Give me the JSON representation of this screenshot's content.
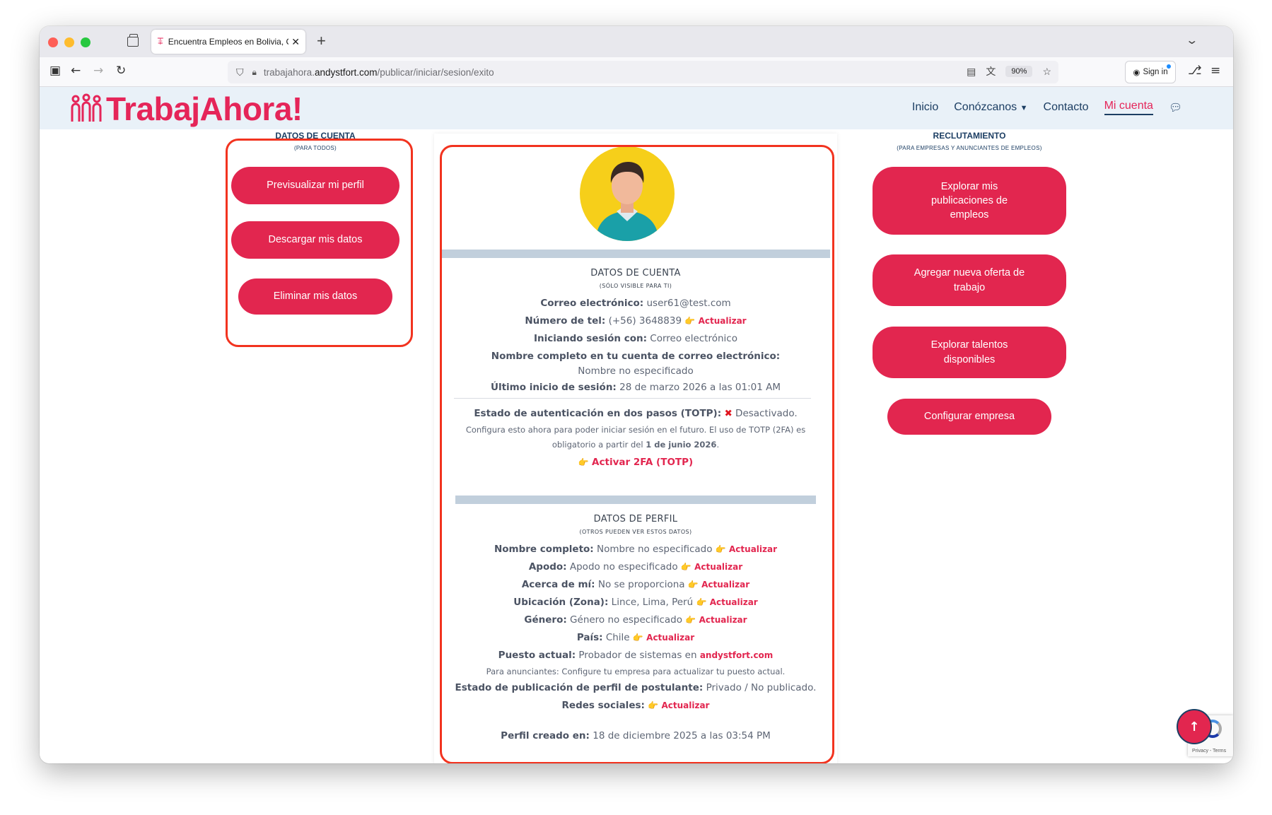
{
  "browser": {
    "tab_title": "Encuentra Empleos en Bolivia, C",
    "url_prefix": "trabajahora.",
    "url_domain": "andystfort.com",
    "url_path": "/publicar/iniciar/sesion/exito",
    "zoom": "90%",
    "signin_label": "Sign in",
    "icons": [
      "tabs-icon",
      "back-arrow-icon",
      "forward-arrow-icon",
      "reload-icon",
      "shield-icon",
      "lock-icon",
      "reader-icon",
      "translate-icon",
      "star-icon",
      "extensions-icon",
      "menu-icon"
    ]
  },
  "site": {
    "logo_text": "TrabajAhora!",
    "nav": {
      "inicio": "Inicio",
      "conozcanos": "Conózcanos",
      "contacto": "Contacto",
      "mi_cuenta": "Mi cuenta"
    }
  },
  "left": {
    "title": "DATOS DE CUENTA",
    "subtitle": "(PARA TODOS)",
    "buttons": {
      "preview": "Previsualizar mi perfil",
      "download": "Descargar mis datos",
      "delete": "Eliminar mis datos"
    }
  },
  "right": {
    "title": "RECLUTAMIENTO",
    "subtitle": "(PARA EMPRESAS Y ANUNCIANTES DE EMPLEOS)",
    "buttons": {
      "explore_posts": "Explorar mis publicaciones de empleos",
      "add_offer": "Agregar nueva oferta de trabajo",
      "explore_talent": "Explorar talentos disponibles",
      "config_company": "Configurar empresa"
    }
  },
  "account": {
    "title": "DATOS DE CUENTA",
    "subtitle": "(SÓLO VISIBLE PARA TI)",
    "email_label": "Correo electrónico:",
    "email_value": "user61@test.com",
    "phone_label": "Número de tel:",
    "phone_value": "(+56) 3648839",
    "login_label": "Iniciando sesión con:",
    "login_value": "Correo electrónico",
    "fullname_label": "Nombre completo en tu cuenta de correo electrónico:",
    "fullname_value": "Nombre no especificado",
    "last_login_label": "Último inicio de sesión:",
    "last_login_value": "28 de marzo 2026 a las 01:01 AM",
    "totp_label": "Estado de autenticación en dos pasos (TOTP):",
    "totp_value": "Desactivado.",
    "totp_note_1": "Configura esto ahora para poder iniciar sesión en el futuro. El uso de TOTP (2FA) es obligatorio a partir del",
    "totp_note_date": "1 de junio 2026",
    "totp_note_end": ".",
    "activate_link": "Activar 2FA (TOTP)",
    "update_label": "Actualizar"
  },
  "profile": {
    "title": "DATOS DE PERFIL",
    "subtitle": "(OTROS PUEDEN VER ESTOS DATOS)",
    "name_label": "Nombre completo:",
    "name_value": "Nombre no especificado",
    "nick_label": "Apodo:",
    "nick_value": "Apodo no especificado",
    "about_label": "Acerca de mí:",
    "about_value": "No se proporciona",
    "location_label": "Ubicación (Zona):",
    "location_value": "Lince, Lima, Perú",
    "gender_label": "Género:",
    "gender_value": "Género no especificado",
    "country_label": "País:",
    "country_value": "Chile",
    "job_label": "Puesto actual:",
    "job_value": "Probador de sistemas en",
    "job_company": "andystfort.com",
    "advertiser_note": "Para anunciantes: Configure tu empresa para actualizar tu puesto actual.",
    "status_label": "Estado de publicación de perfil de postulante:",
    "status_value": "Privado / No publicado.",
    "social_label": "Redes sociales:",
    "created_label": "Perfil creado en:",
    "created_value": "18 de diciembre 2025 a las 03:54 PM",
    "update_label": "Actualizar"
  },
  "recaptcha": {
    "text": "Privacy - Terms"
  },
  "colors": {
    "brand": "#e2264f",
    "navy": "#1c3e63",
    "highlight": "#f2331f"
  }
}
